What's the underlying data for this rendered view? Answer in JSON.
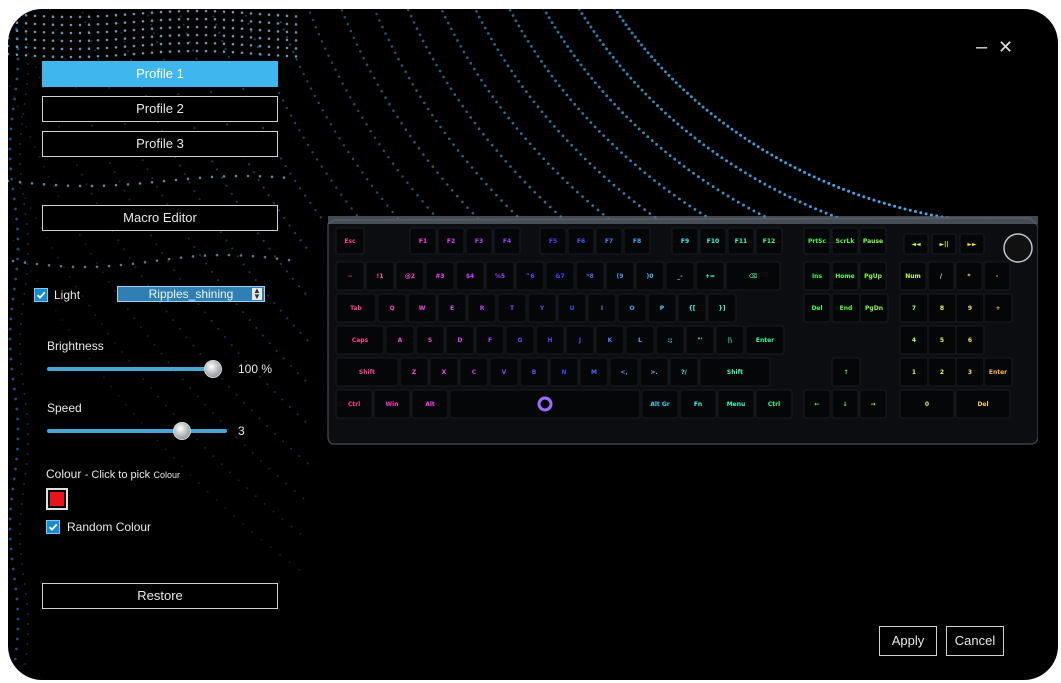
{
  "window": {
    "minimize_glyph": "–",
    "close_glyph": "✕"
  },
  "profiles": [
    {
      "label": "Profile 1",
      "active": true
    },
    {
      "label": "Profile 2",
      "active": false
    },
    {
      "label": "Profile 3",
      "active": false
    }
  ],
  "macro_editor_label": "Macro Editor",
  "light": {
    "label": "Light",
    "checked": true,
    "effect_value": "Ripples_shining"
  },
  "brightness": {
    "label": "Brightness",
    "value_text": "100 %",
    "value": 100,
    "max": 100
  },
  "speed": {
    "label": "Speed",
    "value_text": "3",
    "value": 3,
    "max": 4
  },
  "colour": {
    "label": "Colour",
    "hint_main": "- Click to pick",
    "hint_small": "Colour",
    "swatch": "#e8141a"
  },
  "random_colour": {
    "label": "Random Colour",
    "checked": true
  },
  "restore_label": "Restore",
  "apply_label": "Apply",
  "cancel_label": "Cancel",
  "accent_color": "#3fb6ee",
  "keyboard": {
    "fn_row": [
      "Esc",
      "F1",
      "F2",
      "F3",
      "F4",
      "F5",
      "F6",
      "F7",
      "F8",
      "F9",
      "F10",
      "F11",
      "F12",
      "PrtSc",
      "ScrLk",
      "Pause"
    ],
    "num_row": [
      "~",
      "!1",
      "@2",
      "#3",
      "$4",
      "%5",
      "^6",
      "&7",
      "*8",
      "(9",
      ")0",
      "_-",
      "+=",
      "⌫",
      "Ins",
      "Home",
      "PgUp",
      "Num",
      "/",
      "*",
      "-"
    ],
    "q_row": [
      "Tab",
      "Q",
      "W",
      "E",
      "R",
      "T",
      "Y",
      "U",
      "I",
      "O",
      "P",
      "{[",
      "}]",
      "Del",
      "End",
      "PgDn",
      "7",
      "8",
      "9",
      "+"
    ],
    "a_row": [
      "Caps",
      "A",
      "S",
      "D",
      "F",
      "G",
      "H",
      "J",
      "K",
      "L",
      ":;",
      "\"'",
      "|\\",
      "Enter",
      "4",
      "5",
      "6"
    ],
    "z_row": [
      "Shift",
      "Z",
      "X",
      "C",
      "V",
      "B",
      "N",
      "M",
      "<,",
      ">.",
      "?/",
      "Shift",
      "↑",
      "1",
      "2",
      "3",
      "Enter"
    ],
    "ctrl_row": [
      "Ctrl",
      "Win",
      "Alt",
      "Alt Gr",
      "Fn",
      "Menu",
      "Ctrl",
      "←",
      "↓",
      "→",
      "0",
      "Del"
    ],
    "media": [
      "◄◄",
      "►||",
      "►►"
    ]
  }
}
